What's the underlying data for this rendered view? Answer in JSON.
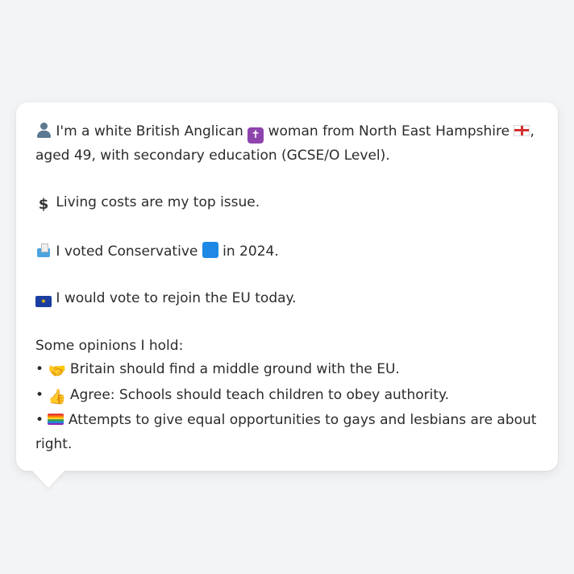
{
  "profile": {
    "intro_line1": "I'm a white British Anglican",
    "intro_line2": "woman from North East Hampshire",
    "intro_line3": ",",
    "intro_line4": "aged 49, with secondary education (GCSE/O Level).",
    "top_issue": "Living costs are my top issue.",
    "vote_part1": "I voted Conservative",
    "vote_part2": "in 2024.",
    "eu_stance": "I would vote to rejoin the EU today.",
    "opinions_heading": "Some opinions I hold:",
    "bullet": "•",
    "opinions": [
      "Britain should find a middle ground with the EU.",
      "Agree: Schools should teach children to obey authority.",
      "Attempts to give equal opportunities to gays and lesbians are about right."
    ]
  },
  "icons": {
    "person": "person-silhouette-icon",
    "cross": "latin-cross-icon",
    "england_flag": "england-flag-icon",
    "dollar": "dollar-sign-icon",
    "ballot": "ballot-box-icon",
    "blue_square": "blue-square-icon",
    "eu_flag": "eu-flag-icon",
    "handshake": "handshake-icon",
    "thumbs_up": "thumbs-up-icon",
    "rainbow_flag": "rainbow-flag-icon"
  },
  "colors": {
    "background": "#f3f4f6",
    "bubble": "#ffffff",
    "text": "#2b2b2b"
  }
}
